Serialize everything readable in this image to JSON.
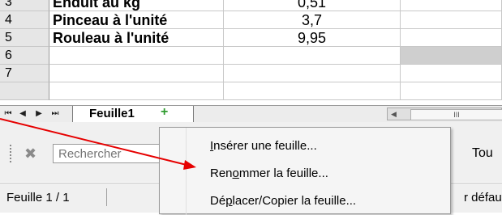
{
  "grid": {
    "rows": [
      {
        "num": "3",
        "item": "Enduit au kg",
        "value": "0,51",
        "shaded": false
      },
      {
        "num": "4",
        "item": "Pinceau à l'unité",
        "value": "3,7",
        "shaded": false
      },
      {
        "num": "5",
        "item": "Rouleau à l'unité",
        "value": "9,95",
        "shaded": false
      },
      {
        "num": "6",
        "item": "",
        "value": "",
        "shaded": true
      },
      {
        "num": "7",
        "item": "",
        "value": "",
        "shaded": false
      }
    ]
  },
  "tabbar": {
    "nav_first": "⏮",
    "nav_prev": "◀",
    "nav_next": "▶",
    "nav_last": "⏭",
    "sheet_tab": "Feuille1",
    "add_icon": "+",
    "scroll_thumb": "III",
    "scroll_left": "◀"
  },
  "findbar": {
    "close_icon": "✖",
    "search_placeholder": "Rechercher",
    "toutes_label": "Tou"
  },
  "statusbar": {
    "sheet_info": "Feuille 1 / 1",
    "page_style": "r défaut"
  },
  "context_menu": {
    "items": [
      {
        "label_pre": "",
        "accel": "I",
        "label_post": "nsérer une feuille..."
      },
      {
        "label_pre": "Ren",
        "accel": "o",
        "label_post": "mmer la feuille..."
      },
      {
        "label_pre": "Dé",
        "accel": "p",
        "label_post": "lacer/Copier la feuille..."
      }
    ]
  },
  "colors": {
    "arrow": "#e60000",
    "add_sheet_icon": "#2e9b2e",
    "shaded_cell": "#cfcfcf"
  }
}
